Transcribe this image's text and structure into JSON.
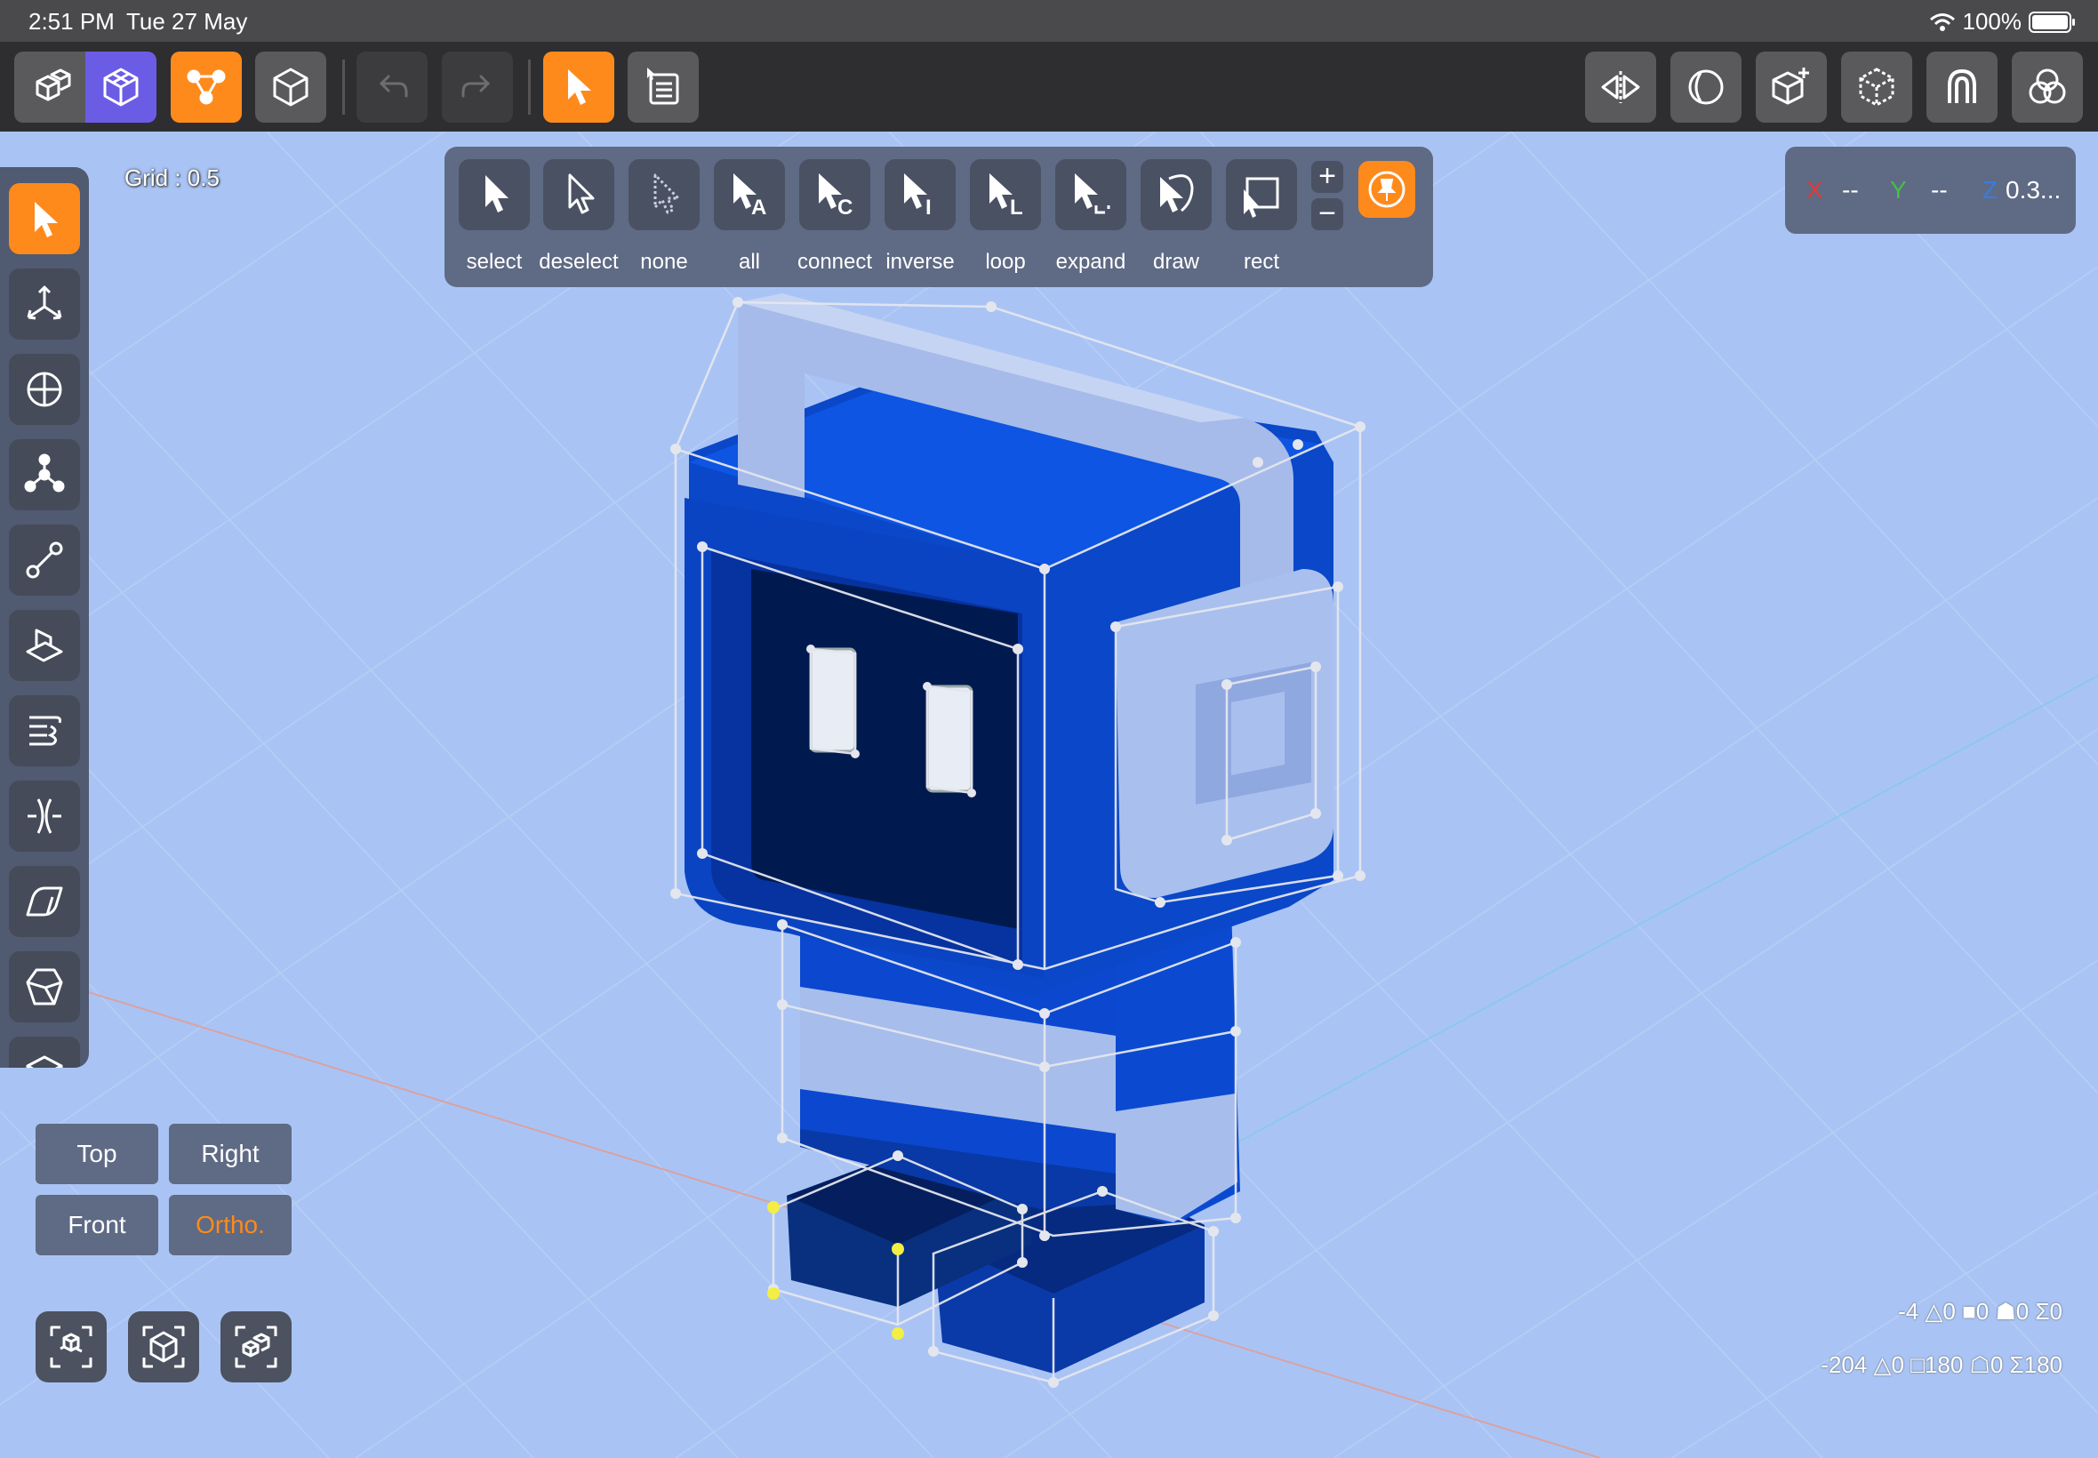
{
  "status_bar": {
    "time": "2:51 PM",
    "date": "Tue 27 May",
    "battery": "100%"
  },
  "toolbar": {
    "items": [
      "object-mode",
      "edit-mode",
      "vertex-mode",
      "object-cube",
      "undo",
      "redo",
      "select-tool",
      "selection-list"
    ],
    "right_items": [
      "mirror",
      "boolean",
      "add-object",
      "wireframe",
      "magnet",
      "overlap"
    ]
  },
  "viewport": {
    "grid_label": "Grid : 0.5"
  },
  "select_toolbar": {
    "tools": [
      {
        "id": "select",
        "label": "select"
      },
      {
        "id": "deselect",
        "label": "deselect"
      },
      {
        "id": "none",
        "label": "none"
      },
      {
        "id": "all",
        "label": "all"
      },
      {
        "id": "connect",
        "label": "connect"
      },
      {
        "id": "inverse",
        "label": "inverse"
      },
      {
        "id": "loop",
        "label": "loop"
      },
      {
        "id": "expand",
        "label": "expand"
      },
      {
        "id": "draw",
        "label": "draw"
      },
      {
        "id": "rect",
        "label": "rect"
      }
    ],
    "plus_label": "+",
    "minus_label": "−"
  },
  "coords": {
    "x_label": "X",
    "x_value": "--",
    "y_label": "Y",
    "y_value": "--",
    "z_label": "Z",
    "z_value": "0.3..."
  },
  "view_buttons": {
    "top": "Top",
    "right": "Right",
    "front": "Front",
    "ortho": "Ortho."
  },
  "stats": {
    "selection": "-4 △0 ■0 ☗0 Σ0",
    "totals": "-204 △0 □180 ☖0 Σ180"
  },
  "colors": {
    "accent": "#ff8a1c",
    "edit_mode": "#6b5ce6",
    "viewport_bg": "#a9c4f4",
    "panel": "#5f6a84",
    "model_blue": "#0a47c9",
    "model_light": "#a9c0ee"
  }
}
